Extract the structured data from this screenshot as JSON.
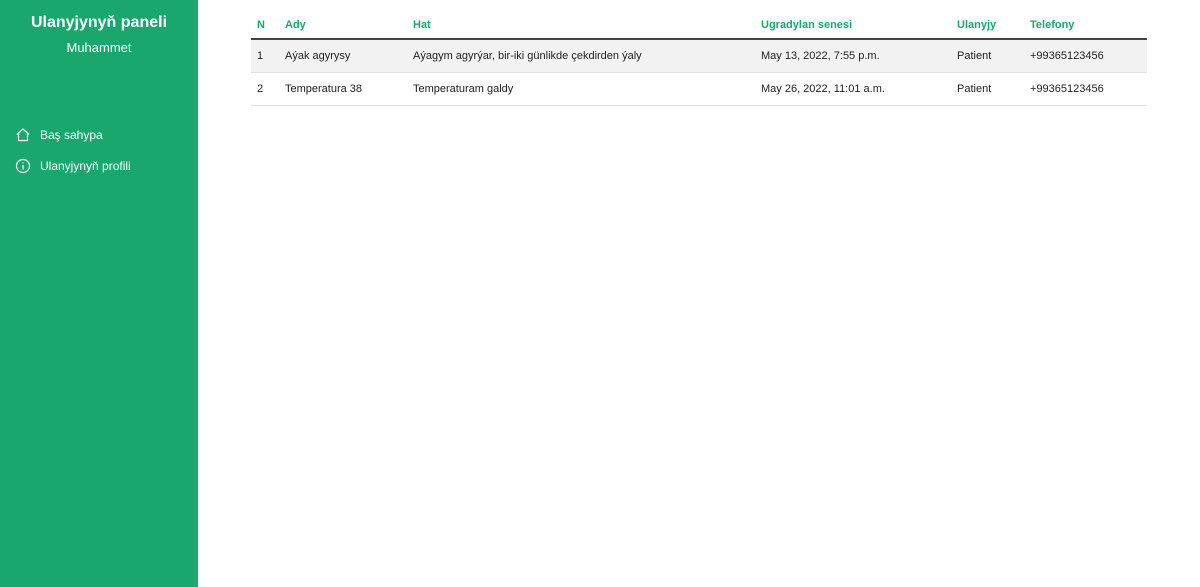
{
  "sidebar": {
    "title": "Ulanyjynyň paneli",
    "user": "Muhammet",
    "items": [
      {
        "label": "Baş sahypa",
        "icon": "home-icon"
      },
      {
        "label": "Ulanyjynyň profili",
        "icon": "info-icon"
      }
    ]
  },
  "table": {
    "headers": [
      "N",
      "Ady",
      "Hat",
      "Ugradylan senesi",
      "Ulanyjy",
      "Telefony"
    ],
    "rows": [
      {
        "n": "1",
        "ady": "Aýak agyrysy",
        "hat": "Aýagym agyrýar, bir-iki günlikde çekdirden ýaly",
        "date": "May 13, 2022, 7:55 p.m.",
        "user": "Patient",
        "phone": "+99365123456"
      },
      {
        "n": "2",
        "ady": "Temperatura 38",
        "hat": "Temperaturam galdy",
        "date": "May 26, 2022, 11:01 a.m.",
        "user": "Patient",
        "phone": "+99365123456"
      }
    ]
  },
  "colors": {
    "accent": "#1aa76e",
    "stripe": "#f2f2f2"
  }
}
